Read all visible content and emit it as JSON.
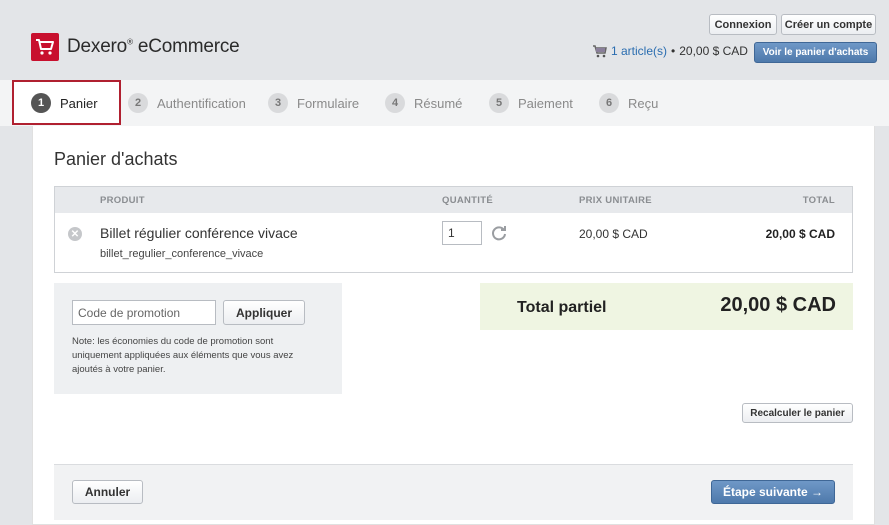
{
  "brand": {
    "name": "Dexero",
    "reg": "®",
    "suffix": " eCommerce",
    "accent": "#c8102e"
  },
  "header": {
    "login_label": "Connexion",
    "signup_label": "Créer un compte",
    "cart_link": "1 article(s)",
    "cart_separator": "•",
    "cart_amount": "20,00 $ CAD",
    "view_cart_label": "Voir le panier d'achats"
  },
  "steps": [
    {
      "num": "1",
      "label": "Panier"
    },
    {
      "num": "2",
      "label": "Authentification"
    },
    {
      "num": "3",
      "label": "Formulaire"
    },
    {
      "num": "4",
      "label": "Résumé"
    },
    {
      "num": "5",
      "label": "Paiement"
    },
    {
      "num": "6",
      "label": "Reçu"
    }
  ],
  "cart": {
    "title": "Panier d'achats",
    "columns": {
      "product": "PRODUIT",
      "quantity": "QUANTITÉ",
      "unit_price": "PRIX UNITAIRE",
      "total": "TOTAL"
    },
    "items": [
      {
        "name": "Billet régulier conférence vivace",
        "sku": "billet_regulier_conference_vivace",
        "quantity": "1",
        "unit_price": "20,00 $ CAD",
        "total": "20,00 $ CAD"
      }
    ],
    "remove_icon": "close-circle-icon",
    "refresh_icon": "refresh-icon"
  },
  "promo": {
    "placeholder": "Code de promotion",
    "apply_label": "Appliquer",
    "note": "Note: les économies du code de promotion sont uniquement appliquées aux éléments que vous avez ajoutés à votre panier."
  },
  "subtotal": {
    "label": "Total partiel",
    "value": "20,00 $ CAD"
  },
  "actions": {
    "recalc_label": "Recalculer le panier",
    "cancel_label": "Annuler",
    "next_label": "Étape suivante →"
  }
}
